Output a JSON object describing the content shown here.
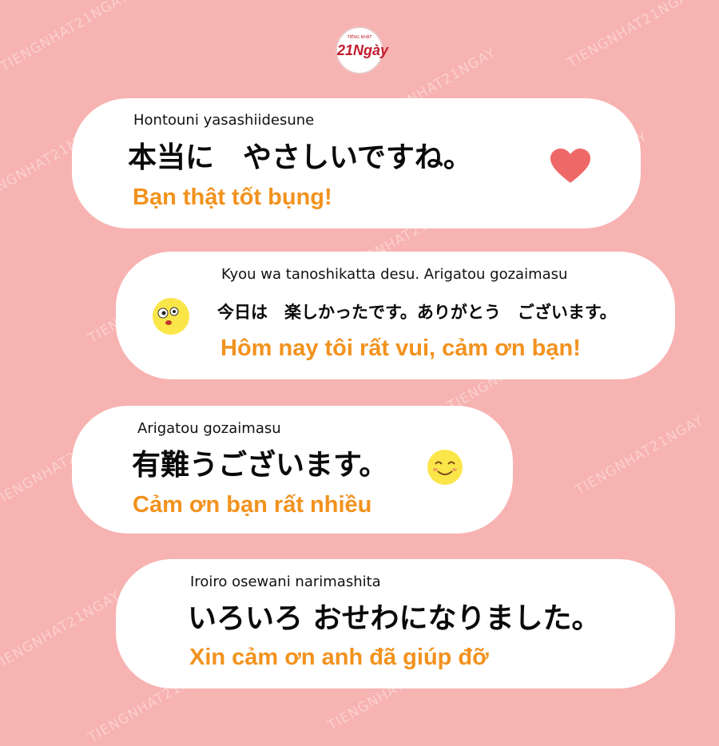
{
  "brand": {
    "tagline": "TIẾNG NHẬT",
    "logo_text": "21Ngày",
    "watermark": "TIENGNHAT21NGAY"
  },
  "colors": {
    "background": "#f7b3b1",
    "bubble": "#ffffff",
    "translation": "#f2921e",
    "heart": "#ef6868",
    "emoji_face": "#fbe64a"
  },
  "phrases": [
    {
      "romaji": "Hontouni yasashiidesune",
      "japanese": "本当に　やさしいですね。",
      "vietnamese": "Bạn thật tốt bụng!",
      "icon": "heart-icon"
    },
    {
      "romaji": "Kyou wa tanoshikatta desu. Arigatou gozaimasu",
      "japanese": "今日は　楽しかったです。ありがとう　ございます。",
      "vietnamese": "Hôm nay tôi rất vui, cảm ơn bạn!",
      "icon": "surprised-face-icon"
    },
    {
      "romaji": "Arigatou gozaimasu",
      "japanese": "有難うございます。",
      "vietnamese": "Cảm ơn bạn rất nhiều",
      "icon": "smiling-face-icon"
    },
    {
      "romaji": "Iroiro osewani narimashita",
      "japanese": "いろいろ おせわになりました。",
      "vietnamese": "Xin cảm ơn anh đã giúp đỡ",
      "icon": ""
    }
  ]
}
